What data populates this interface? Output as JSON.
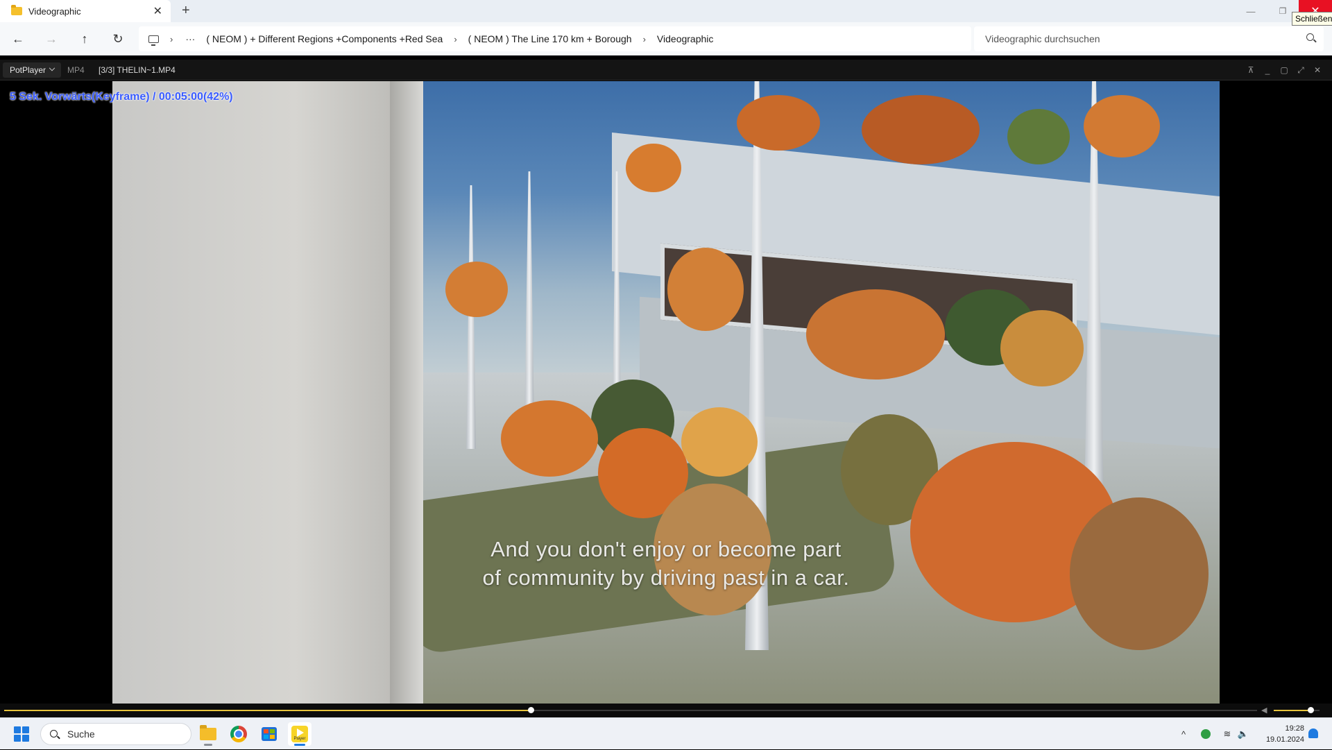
{
  "explorer": {
    "tab_title": "Videographic",
    "tab_close": "✕",
    "new_tab": "+",
    "window_controls": {
      "minimize": "—",
      "maximize": "❐",
      "close": "✕"
    },
    "tooltip": "Schließen",
    "nav": {
      "back": "←",
      "forward": "→",
      "up": "↑",
      "refresh": "↻"
    },
    "breadcrumb": {
      "overflow": "···",
      "separator": "›",
      "items": [
        "( NEOM ) + Different Regions +Components +Red Sea",
        "( NEOM ) The Line 170 km + Borough",
        "Videographic"
      ]
    },
    "search_placeholder": "Videographic durchsuchen"
  },
  "player": {
    "menu_label": "PotPlayer",
    "format": "MP4",
    "file_name": "[3/3] THELIN~1.MP4",
    "title_controls": {
      "pin": "⊼",
      "minimize": "_",
      "maximize": "▢",
      "fullscreen": "⤢",
      "close": "✕"
    },
    "osd_text": "5  Sek. Vorwärts(Keyframe) / 00:05:00(42%)",
    "subtitle_line1": "And you don't enjoy or become part",
    "subtitle_line2": "of community by driving past in a car.",
    "progress_percent": 42,
    "volume_percent": 80,
    "accent_color": "#e7c43b",
    "osd_color": "#3a5cff"
  },
  "taskbar": {
    "search_label": "Suche",
    "apps": [
      {
        "name": "file-explorer",
        "icon": "folder-icon"
      },
      {
        "name": "chrome",
        "icon": "chrome-icon"
      },
      {
        "name": "microsoft-store",
        "icon": "store-icon"
      },
      {
        "name": "potplayer",
        "icon": "potplayer-icon",
        "label": "Player"
      }
    ],
    "tray": {
      "chevron": "^",
      "wifi": "≋",
      "volume": "🔈"
    },
    "time": "19:28",
    "date": "19.01.2024",
    "accent_color": "#1e7ae0"
  }
}
